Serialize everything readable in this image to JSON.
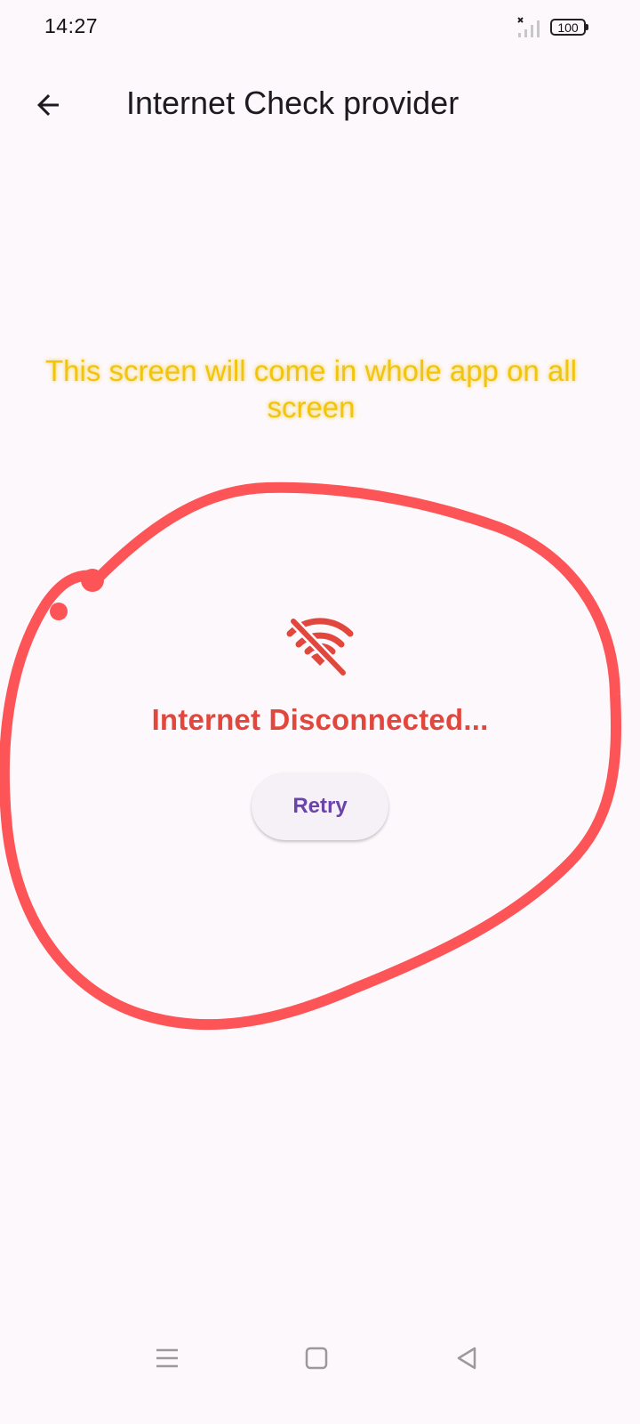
{
  "status_bar": {
    "time": "14:27",
    "battery": "100",
    "signal_icon": "signal-no-service-icon"
  },
  "app_bar": {
    "title": "Internet Check provider",
    "back_icon": "arrow-back-icon"
  },
  "annotation": {
    "text": "This screen will come in whole app on all screen",
    "color": "#f1c40f",
    "circle_color": "#fc5457"
  },
  "content": {
    "icon": "wifi-off-icon",
    "icon_color": "#e2473d",
    "message": "Internet Disconnected...",
    "message_color": "#e2473d",
    "retry_label": "Retry",
    "retry_color": "#6a44a9"
  },
  "nav_bar": {
    "menu_icon": "menu-icon",
    "home_icon": "home-square-icon",
    "back_icon": "back-triangle-icon"
  },
  "colors": {
    "background": "#fdf8fb"
  }
}
